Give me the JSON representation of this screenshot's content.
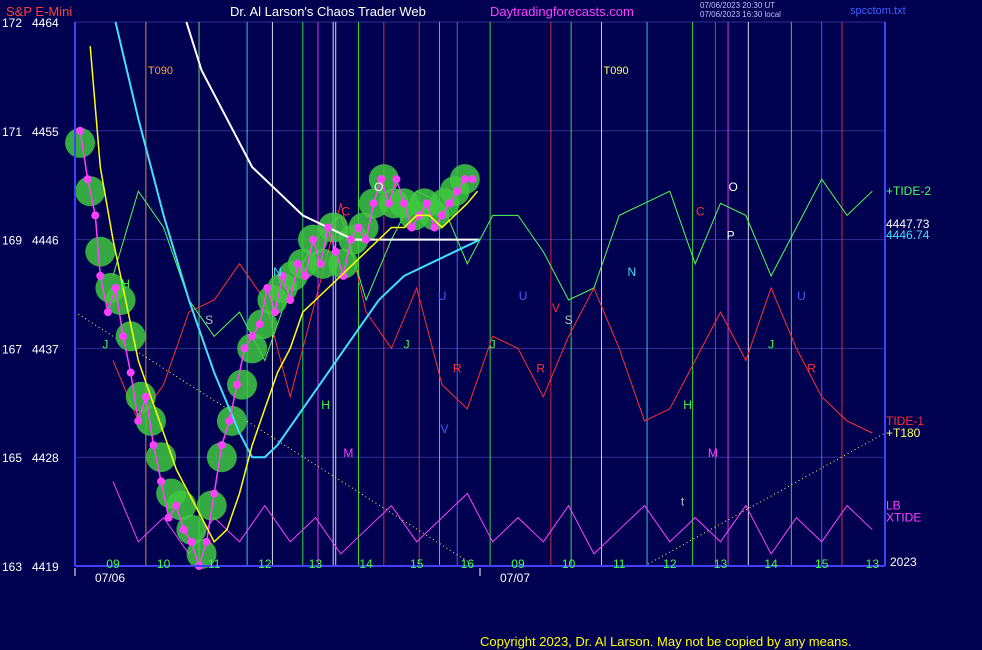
{
  "header": {
    "symbol": "S&P E-Mini",
    "source": "Dr. Al Larson's Chaos Trader Web",
    "website": "Daytradingforecasts.com",
    "timestamp1": "07/06/2023 20:30 UT",
    "timestamp2": "07/06/2023 16:30 local",
    "file": "spcctom.txt"
  },
  "copyright": "Copyright 2023, Dr. Al Larson. May not be copied by any means.",
  "colors": {
    "background": "#000050",
    "axis": "#4040ff",
    "price": "#ff40ff",
    "fast_avg": "#ffff00",
    "slow_avg": "#40e0ff",
    "white_curve": "#ffffff",
    "tide1": "#ff3030",
    "tide2": "#50ff50",
    "xtide": "#ff40ff",
    "green_band": "#40c840"
  },
  "chart_data": {
    "type": "line",
    "title": "S&P E-Mini",
    "y_axis": {
      "ylim": [
        4419,
        4464
      ],
      "ticks": [
        {
          "index": "163",
          "price": "4419",
          "value": 4419
        },
        {
          "index": "165",
          "price": "4428",
          "value": 4428
        },
        {
          "index": "167",
          "price": "4437",
          "value": 4437
        },
        {
          "index": "169",
          "price": "4446",
          "value": 4446
        },
        {
          "index": "171",
          "price": "4455",
          "value": 4455
        },
        {
          "index": "172",
          "price": "4464",
          "value": 4464
        }
      ]
    },
    "x_axis": {
      "xlim": [
        0,
        32
      ],
      "hour_ticks": [
        {
          "label": "09",
          "x": 1.5
        },
        {
          "label": "10",
          "x": 3.5
        },
        {
          "label": "11",
          "x": 5.5
        },
        {
          "label": "12",
          "x": 7.5
        },
        {
          "label": "13",
          "x": 9.5
        },
        {
          "label": "14",
          "x": 11.5
        },
        {
          "label": "15",
          "x": 13.5
        },
        {
          "label": "16",
          "x": 15.5
        },
        {
          "label": "09",
          "x": 17.5
        },
        {
          "label": "10",
          "x": 19.5
        },
        {
          "label": "11",
          "x": 21.5
        },
        {
          "label": "12",
          "x": 23.5
        },
        {
          "label": "13",
          "x": 25.5
        },
        {
          "label": "14",
          "x": 27.5
        },
        {
          "label": "15",
          "x": 29.5
        },
        {
          "label": "13",
          "x": 31.5
        }
      ],
      "date_labels": [
        {
          "label": "07/06",
          "x": 1.5
        },
        {
          "label": "07/07",
          "x": 17.5
        }
      ],
      "year": "2023"
    },
    "series": [
      {
        "key": "price",
        "x": [
          0.2,
          0.5,
          0.8,
          1.0,
          1.3,
          1.6,
          1.9,
          2.2,
          2.5,
          2.8,
          3.1,
          3.4,
          3.7,
          4.0,
          4.3,
          4.6,
          4.9,
          5.2,
          5.5,
          5.8,
          6.1,
          6.4,
          6.7,
          7.0,
          7.3,
          7.6,
          7.9,
          8.2,
          8.5,
          8.8,
          9.1,
          9.4,
          9.7,
          10.0,
          10.3,
          10.6,
          10.9,
          11.2,
          11.5,
          11.8,
          12.1,
          12.4,
          12.7,
          13.0,
          13.3,
          13.6,
          13.9,
          14.2,
          14.5,
          14.8,
          15.1,
          15.4,
          15.7
        ],
        "values": [
          4455,
          4451,
          4448,
          4443,
          4440,
          4442,
          4438,
          4435,
          4431,
          4433,
          4429,
          4426,
          4423,
          4424,
          4422,
          4421,
          4419,
          4421,
          4425,
          4429,
          4431,
          4434,
          4437,
          4438,
          4439,
          4442,
          4440,
          4443,
          4441,
          4444,
          4443,
          4446,
          4444,
          4447,
          4445,
          4443,
          4446,
          4447,
          4446,
          4449,
          4451,
          4449,
          4451,
          4449,
          4447,
          4448,
          4449,
          4447,
          4448,
          4449,
          4450,
          4451,
          4451
        ]
      },
      {
        "key": "fast_avg",
        "x": [
          0.6,
          1.0,
          1.5,
          2.0,
          2.5,
          3.0,
          3.5,
          4.0,
          4.5,
          5.0,
          5.5,
          6.0,
          6.5,
          7.0,
          7.5,
          8.0,
          8.5,
          9.0,
          9.5,
          10.0,
          10.5,
          11.0,
          11.5,
          12.0,
          12.5,
          13.0,
          13.5,
          14.0,
          14.5,
          15.0,
          15.5,
          15.9
        ],
        "values": [
          4462,
          4452,
          4446,
          4441,
          4436,
          4433,
          4430,
          4427,
          4425,
          4423,
          4421,
          4422,
          4425,
          4429,
          4432,
          4435,
          4437,
          4440,
          4441,
          4442,
          4443,
          4444,
          4445,
          4446,
          4447,
          4447,
          4448,
          4448,
          4447,
          4448,
          4449,
          4450
        ]
      },
      {
        "key": "slow_avg",
        "x": [
          1.6,
          2.5,
          3.5,
          4.5,
          5.5,
          6.5,
          7.0,
          7.5,
          8.0,
          9.0,
          10.0,
          11.0,
          12.0,
          13.0,
          14.0,
          15.0,
          16.0
        ],
        "values": [
          4464,
          4456,
          4448,
          4441,
          4435,
          4430,
          4428,
          4428,
          4429,
          4432,
          4435,
          4438,
          4441,
          4443,
          4444,
          4445,
          4446
        ]
      },
      {
        "key": "white_curve",
        "x": [
          4.4,
          5.0,
          6.0,
          7.0,
          8.0,
          9.0,
          10.0,
          11.0,
          12.0,
          13.0,
          14.0,
          15.0,
          16.0
        ],
        "values": [
          4464,
          4460,
          4456,
          4452,
          4450,
          4448,
          4447,
          4446,
          4446,
          4446,
          4446,
          4446,
          4446
        ]
      },
      {
        "key": "tide2",
        "x": [
          1.5,
          2.5,
          3.5,
          4.5,
          5.5,
          6.5,
          7.5,
          8.5,
          9.5,
          10.5,
          11.5,
          12.5,
          13.5,
          14.5,
          15.5,
          16.5,
          17.5,
          18.5,
          19.5,
          20.5,
          21.5,
          22.5,
          23.5,
          24.5,
          25.5,
          26.5,
          27.5,
          28.5,
          29.5,
          30.5,
          31.5
        ],
        "values": [
          4443,
          4450,
          4447,
          4441,
          4438,
          4440,
          4436,
          4442,
          4446,
          4448,
          4441,
          4446,
          4450,
          4449,
          4444,
          4448,
          4448,
          4445,
          4441,
          4442,
          4448,
          4449,
          4450,
          4444,
          4449,
          4448,
          4443,
          4447,
          4451,
          4448,
          4450
        ]
      },
      {
        "key": "tide1",
        "x": [
          1.5,
          2.5,
          3.5,
          4.5,
          5.5,
          6.5,
          7.5,
          8.5,
          9.5,
          10.5,
          11.5,
          12.5,
          13.5,
          14.5,
          15.5,
          16.5,
          17.5,
          18.5,
          19.5,
          20.5,
          21.5,
          22.5,
          23.5,
          24.5,
          25.5,
          26.5,
          27.5,
          28.5,
          29.5,
          30.5,
          31.5
        ],
        "values": [
          4436,
          4431,
          4434,
          4440,
          4441,
          4444,
          4441,
          4433,
          4441,
          4449,
          4440,
          4437,
          4442,
          4434,
          4432,
          4438,
          4437,
          4433,
          4438,
          4442,
          4437,
          4431,
          4432,
          4436,
          4440,
          4436,
          4442,
          4437,
          4433,
          4431,
          4430
        ]
      },
      {
        "key": "xtide",
        "x": [
          1.5,
          2.5,
          3.5,
          4.5,
          5.5,
          6.5,
          7.5,
          8.5,
          9.5,
          10.5,
          11.5,
          12.5,
          13.5,
          14.5,
          15.5,
          16.5,
          17.5,
          18.5,
          19.5,
          20.5,
          21.5,
          22.5,
          23.5,
          24.5,
          25.5,
          26.5,
          27.5,
          28.5,
          29.5,
          30.5,
          31.5
        ],
        "values": [
          4426,
          4421,
          4423,
          4420,
          4423,
          4421,
          4424,
          4421,
          4423,
          4420,
          4422,
          4424,
          4421,
          4423,
          4425,
          4421,
          4423,
          4421,
          4424,
          4420,
          4422,
          4424,
          4421,
          4423,
          4421,
          4424,
          4420,
          4423,
          4421,
          4424,
          4422
        ]
      }
    ],
    "green_band": {
      "x": [
        0.2,
        0.6,
        1.0,
        1.4,
        1.8,
        2.2,
        2.6,
        3.0,
        3.4,
        3.8,
        4.2,
        4.6,
        5.0,
        5.4,
        5.8,
        6.2,
        6.6,
        7.0,
        7.4,
        7.8,
        8.2,
        8.6,
        9.0,
        9.4,
        9.8,
        10.2,
        10.6,
        11.0,
        11.4,
        11.8,
        12.2,
        12.6,
        13.0,
        13.4,
        13.8,
        14.2,
        14.6,
        15.0,
        15.4
      ],
      "values": [
        4454,
        4450,
        4445,
        4442,
        4441,
        4438,
        4433,
        4431,
        4428,
        4425,
        4424,
        4422,
        4420,
        4424,
        4428,
        4431,
        4434,
        4437,
        4439,
        4441,
        4442,
        4443,
        4444,
        4446,
        4444,
        4447,
        4444,
        4446,
        4447,
        4449,
        4451,
        4449,
        4449,
        4448,
        4449,
        4448,
        4449,
        4450,
        4451
      ]
    },
    "vertical_lines": [
      {
        "x": 2.8,
        "color": "#ffa040",
        "label": "T090"
      },
      {
        "x": 4.9,
        "color": "#80ff80",
        "label": ""
      },
      {
        "x": 6.8,
        "color": "#40e0ff",
        "label": ""
      },
      {
        "x": 7.8,
        "color": "#ffffff",
        "label": ""
      },
      {
        "x": 9.0,
        "color": "#40ff40",
        "label": ""
      },
      {
        "x": 9.6,
        "color": "#ff40ff",
        "label": ""
      },
      {
        "x": 10.2,
        "color": "#ffffff",
        "label": ""
      },
      {
        "x": 10.3,
        "color": "#ffffff",
        "label": ""
      },
      {
        "x": 11.2,
        "color": "#40ff40",
        "label": ""
      },
      {
        "x": 12.2,
        "color": "#ff3030",
        "label": ""
      },
      {
        "x": 13.6,
        "color": "#ff3030",
        "label": ""
      },
      {
        "x": 14.4,
        "color": "#40ff40",
        "label": ""
      },
      {
        "x": 15.1,
        "color": "#4080ff",
        "label": ""
      },
      {
        "x": 16.4,
        "color": "#40ff40",
        "label": ""
      },
      {
        "x": 18.8,
        "color": "#ff3030",
        "label": ""
      },
      {
        "x": 19.6,
        "color": "#40ff40",
        "label": ""
      },
      {
        "x": 20.8,
        "color": "#ffff60",
        "label": "T090"
      },
      {
        "x": 22.6,
        "color": "#40e0ff",
        "label": ""
      },
      {
        "x": 24.4,
        "color": "#40ff40",
        "label": ""
      },
      {
        "x": 25.3,
        "color": "#ff3030",
        "label": ""
      },
      {
        "x": 25.8,
        "color": "#ff40ff",
        "label": ""
      },
      {
        "x": 26.6,
        "color": "#ffffff",
        "label": ""
      },
      {
        "x": 28.3,
        "color": "#40ff40",
        "label": ""
      },
      {
        "x": 29.5,
        "color": "#4080ff",
        "label": ""
      },
      {
        "x": 30.3,
        "color": "#ff3030",
        "label": ""
      }
    ],
    "letters": [
      {
        "t": "J",
        "x": 1.2,
        "y": 4437,
        "c": "#40ff40"
      },
      {
        "t": "H",
        "x": 2.0,
        "y": 4442,
        "c": "#40ff40"
      },
      {
        "t": "S",
        "x": 5.3,
        "y": 4439,
        "c": "#c0c0c0"
      },
      {
        "t": "N",
        "x": 8.0,
        "y": 4443,
        "c": "#40e0ff"
      },
      {
        "t": "H",
        "x": 9.9,
        "y": 4432,
        "c": "#40ff40"
      },
      {
        "t": "C",
        "x": 10.7,
        "y": 4448,
        "c": "#ff3030"
      },
      {
        "t": "M",
        "x": 10.8,
        "y": 4428,
        "c": "#ff40ff"
      },
      {
        "t": "O",
        "x": 12.0,
        "y": 4450,
        "c": "#ffffff"
      },
      {
        "t": "J",
        "x": 13.1,
        "y": 4437,
        "c": "#40ff40"
      },
      {
        "t": "U",
        "x": 14.5,
        "y": 4441,
        "c": "#4060ff"
      },
      {
        "t": "R",
        "x": 15.1,
        "y": 4435,
        "c": "#ff3030"
      },
      {
        "t": "V",
        "x": 14.6,
        "y": 4430,
        "c": "#4060ff"
      },
      {
        "t": "J",
        "x": 16.5,
        "y": 4437,
        "c": "#40ff40"
      },
      {
        "t": "U",
        "x": 17.7,
        "y": 4441,
        "c": "#4060ff"
      },
      {
        "t": "R",
        "x": 18.4,
        "y": 4435,
        "c": "#ff3030"
      },
      {
        "t": "V",
        "x": 19.0,
        "y": 4440,
        "c": "#ff3030"
      },
      {
        "t": "S",
        "x": 19.5,
        "y": 4439,
        "c": "#c0c0c0"
      },
      {
        "t": "N",
        "x": 22.0,
        "y": 4443,
        "c": "#40e0ff"
      },
      {
        "t": "H",
        "x": 24.2,
        "y": 4432,
        "c": "#40ff40"
      },
      {
        "t": "C",
        "x": 24.7,
        "y": 4448,
        "c": "#ff3030"
      },
      {
        "t": "M",
        "x": 25.2,
        "y": 4428,
        "c": "#ff40ff"
      },
      {
        "t": "t",
        "x": 24.0,
        "y": 4424,
        "c": "#c0c0c0"
      },
      {
        "t": "O",
        "x": 26.0,
        "y": 4450,
        "c": "#ffffff"
      },
      {
        "t": "P",
        "x": 25.9,
        "y": 4446,
        "c": "#ffffff"
      },
      {
        "t": "J",
        "x": 27.5,
        "y": 4437,
        "c": "#40ff40"
      },
      {
        "t": "U",
        "x": 28.7,
        "y": 4441,
        "c": "#4060ff"
      },
      {
        "t": "R",
        "x": 29.1,
        "y": 4435,
        "c": "#ff3030"
      }
    ],
    "right_labels": [
      {
        "t": "+TIDE-2",
        "y": 4450,
        "c": "#50ff50"
      },
      {
        "t": "4447.73",
        "y": 4447.3,
        "c": "#ffffff"
      },
      {
        "t": "4446.74",
        "y": 4446.4,
        "c": "#40e0ff"
      },
      {
        "t": "TIDE-1",
        "y": 4431,
        "c": "#ff3030"
      },
      {
        "t": "+T180",
        "y": 4430,
        "c": "#ffff60"
      },
      {
        "t": "LB",
        "y": 4424,
        "c": "#ff40ff"
      },
      {
        "t": "XTIDE",
        "y": 4423,
        "c": "#ff40ff"
      }
    ]
  }
}
